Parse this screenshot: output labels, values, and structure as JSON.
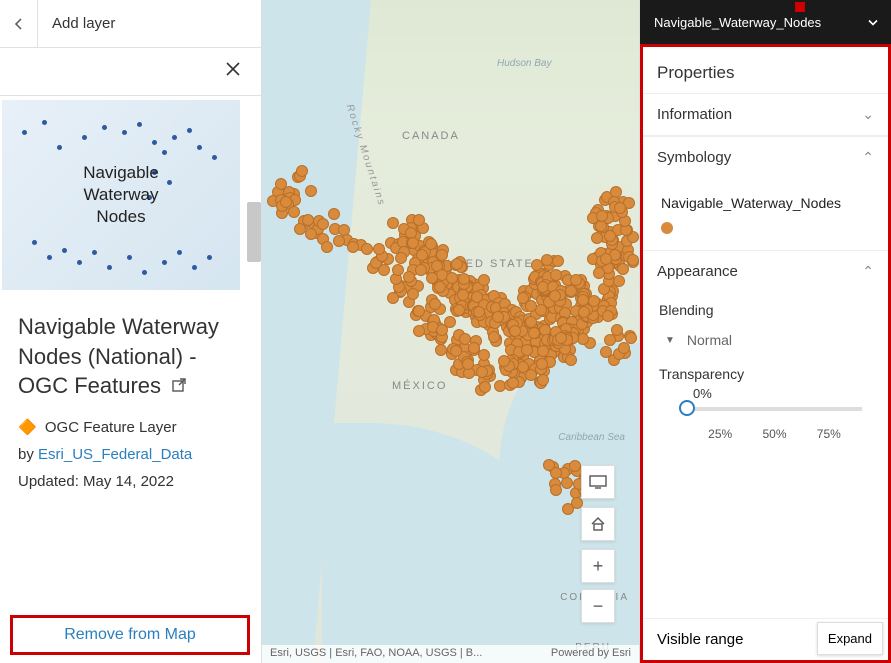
{
  "header": {
    "title": "Add layer"
  },
  "layer": {
    "thumb_text": "Navigable Waterway Nodes",
    "title": "Navigable Waterway Nodes (National) - OGC Features",
    "type_label": "OGC Feature Layer",
    "by_prefix": "by ",
    "author": "Esri_US_Federal_Data",
    "updated": "Updated: May 14, 2022",
    "remove_label": "Remove from Map"
  },
  "map": {
    "labels": {
      "canada": "CANADA",
      "us": "UNITED STATES",
      "mexico": "MÉXICO",
      "hudson": "Hudson Bay",
      "carib": "Caribbean Sea",
      "colombia": "COLOMBIA",
      "rocky": "Rocky Mountains",
      "peru": "PERU"
    },
    "attrib_left": "Esri, USGS | Esri, FAO, NOAA, USGS | B...",
    "attrib_right": "Powered by Esri"
  },
  "right": {
    "header": "Navigable_Waterway_Nodes",
    "properties_title": "Properties",
    "sections": {
      "information": "Information",
      "symbology": "Symbology",
      "appearance": "Appearance",
      "visible_range": "Visible range"
    },
    "symbology": {
      "item_label": "Navigable_Waterway_Nodes"
    },
    "appearance": {
      "blending_label": "Blending",
      "blending_value": "Normal",
      "transparency_label": "Transparency",
      "transparency_value": "0%",
      "ticks": {
        "t1": "25%",
        "t2": "50%",
        "t3": "75%"
      }
    },
    "expand_label": "Expand"
  }
}
